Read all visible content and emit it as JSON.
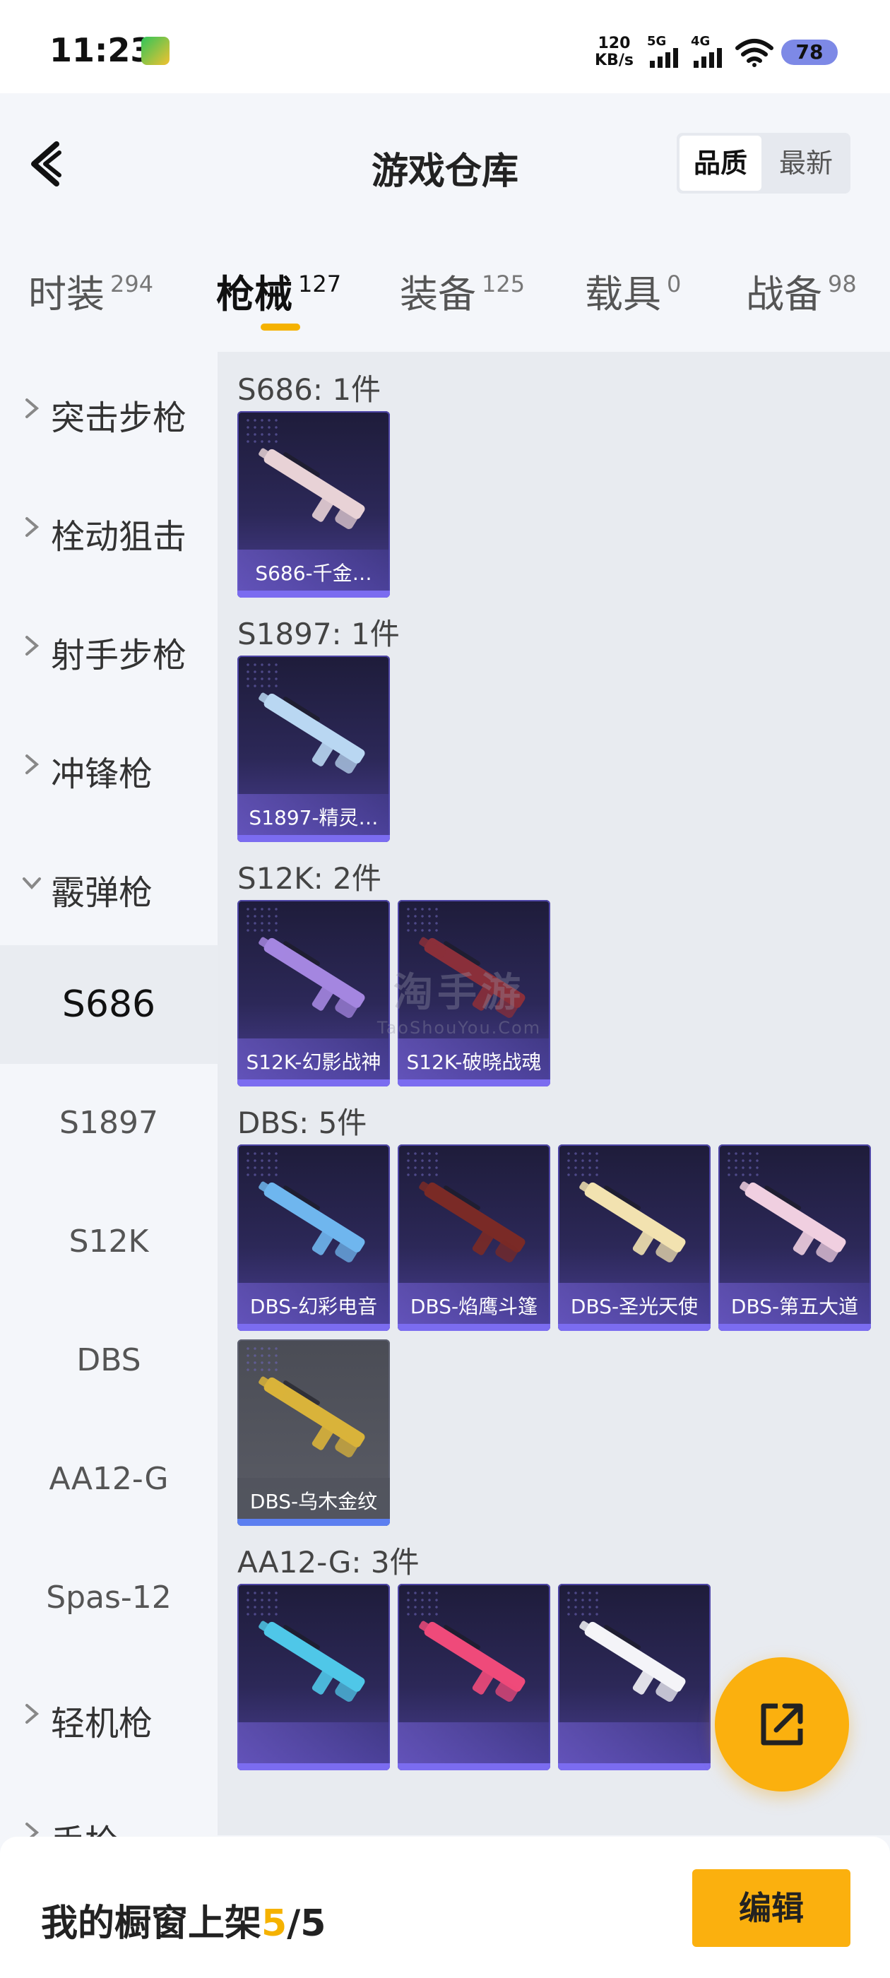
{
  "status_bar": {
    "time": "11:23",
    "speed_value": "120",
    "speed_unit": "KB/s",
    "signal1_label": "5G",
    "signal2_label": "4G",
    "battery": "78"
  },
  "header": {
    "title": "游戏仓库",
    "sort_options": [
      "品质",
      "最新"
    ],
    "active_sort": "品质"
  },
  "tabs": [
    {
      "label": "时装",
      "count": "294",
      "active": false
    },
    {
      "label": "枪械",
      "count": "127",
      "active": true
    },
    {
      "label": "装备",
      "count": "125",
      "active": false
    },
    {
      "label": "载具",
      "count": "0",
      "active": false
    },
    {
      "label": "战备",
      "count": "98",
      "active": false
    }
  ],
  "sidebar": {
    "categories_top": [
      "突击步枪",
      "栓动狙击",
      "射手步枪",
      "冲锋枪"
    ],
    "expanded_category": "霰弹枪",
    "subcategories": [
      "S686",
      "S1897",
      "S12K",
      "DBS",
      "AA12-G",
      "Spas-12"
    ],
    "selected_subcategory": "S686",
    "categories_bottom": [
      "轻机枪",
      "手枪"
    ]
  },
  "groups": [
    {
      "title": "S686: 1件",
      "items": [
        {
          "name": "S686-千金…",
          "style": "purple",
          "gun": "#e8d2d6"
        }
      ]
    },
    {
      "title": "S1897: 1件",
      "items": [
        {
          "name": "S1897-精灵…",
          "style": "purple",
          "gun": "#b9d7f2"
        }
      ]
    },
    {
      "title": "S12K: 2件",
      "items": [
        {
          "name": "S12K-幻影战神",
          "style": "purple",
          "gun": "#a486e0"
        },
        {
          "name": "S12K-破晓战魂",
          "style": "purple",
          "gun": "#8a2f3a"
        }
      ]
    },
    {
      "title": "DBS: 5件",
      "items": [
        {
          "name": "DBS-幻彩电音",
          "style": "purple",
          "gun": "#6fb6ee"
        },
        {
          "name": "DBS-焰鹰斗篷",
          "style": "purple",
          "gun": "#7a2a26"
        },
        {
          "name": "DBS-圣光天使",
          "style": "purple",
          "gun": "#f2e2b0"
        },
        {
          "name": "DBS-第五大道",
          "style": "purple",
          "gun": "#f0cfe0"
        },
        {
          "name": "DBS-乌木金纹",
          "style": "gray",
          "gun": "#d9b33a"
        }
      ]
    },
    {
      "title": "AA12-G: 3件",
      "items": [
        {
          "name": "",
          "style": "purple",
          "gun": "#4fc7e8"
        },
        {
          "name": "",
          "style": "purple",
          "gun": "#ef4a7a"
        },
        {
          "name": "",
          "style": "purple",
          "gun": "#f4f4f8"
        }
      ]
    }
  ],
  "watermark": {
    "line1": "淘手游",
    "line2": "TaoShouYou.Com"
  },
  "bottom": {
    "showcase_label": "我的橱窗上架",
    "showcase_current": "5",
    "showcase_sep": "/",
    "showcase_total": "5",
    "edit_label": "编辑"
  },
  "colors": {
    "accent": "#fbb00e",
    "card_purple": "#2c2858",
    "card_gray": "#55575f"
  }
}
